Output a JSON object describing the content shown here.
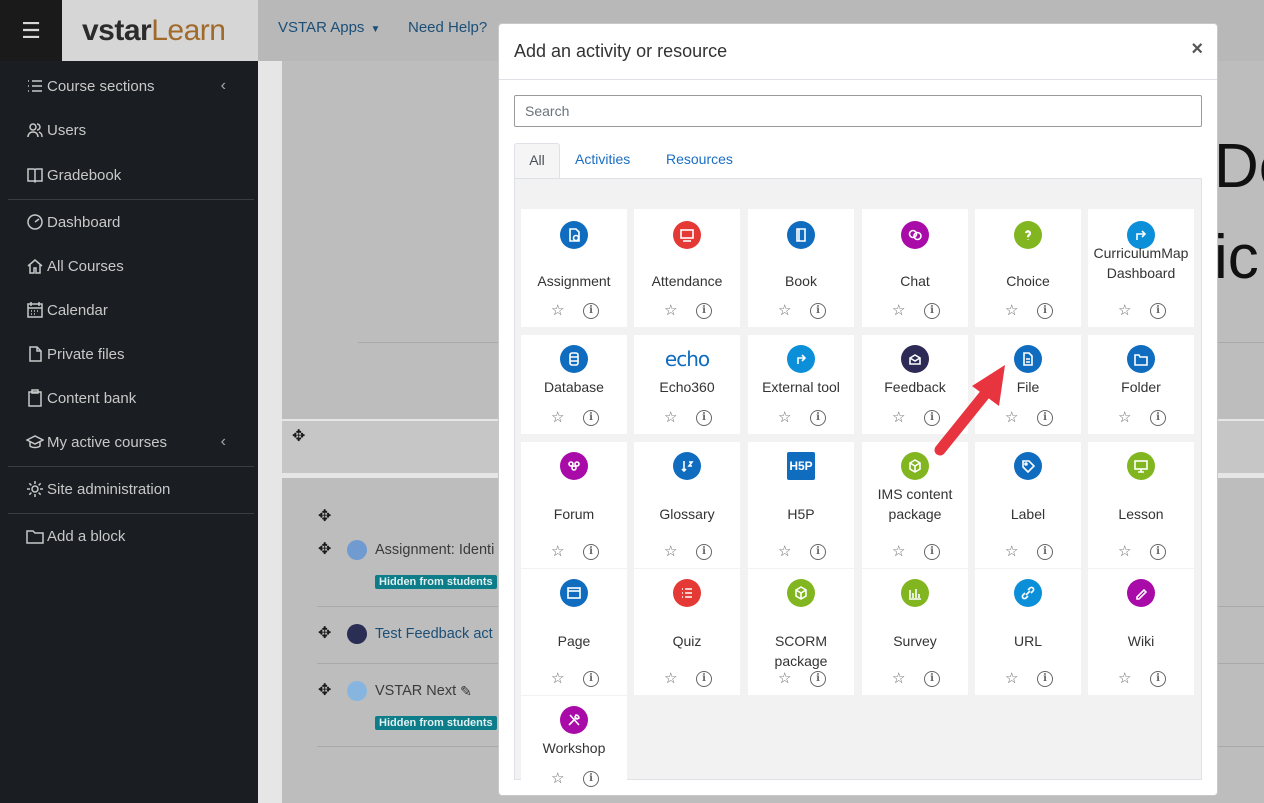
{
  "navbar": {
    "toggle_icon": "hamburger-icon",
    "logo": {
      "part1": "vstar",
      "part2": "Learn"
    },
    "apps_label": "VSTAR Apps",
    "help_label": "Need Help?"
  },
  "sidebar": {
    "items": [
      {
        "label": "Course sections",
        "icon": "list-icon"
      },
      {
        "label": "Users",
        "icon": "users-icon"
      },
      {
        "label": "Gradebook",
        "icon": "gradebook-icon"
      },
      {
        "label": "Dashboard",
        "icon": "dashboard-icon"
      },
      {
        "label": "All Courses",
        "icon": "home-icon"
      },
      {
        "label": "Calendar",
        "icon": "calendar-icon"
      },
      {
        "label": "Private files",
        "icon": "file-icon"
      },
      {
        "label": "Content bank",
        "icon": "clipboard-icon"
      },
      {
        "label": "My active courses",
        "icon": "graduation-cap-icon"
      },
      {
        "label": "Site administration",
        "icon": "gear-icon"
      },
      {
        "label": "Add a block",
        "icon": "folder-icon"
      }
    ]
  },
  "page": {
    "big_text_1": "De",
    "big_text_2": "ic",
    "activities": [
      {
        "name": "Assignment: Identi",
        "badge": "Hidden from students",
        "color": "#5b8fcf"
      },
      {
        "name": "Test Feedback act",
        "badge": "",
        "color": "#2a2d54"
      },
      {
        "name": "VSTAR Next",
        "badge": "Hidden from students",
        "color": "#6aa8de"
      }
    ]
  },
  "modal": {
    "title": "Add an activity or resource",
    "close": "×",
    "search_placeholder": "Search",
    "tabs": [
      "All",
      "Activities",
      "Resources"
    ],
    "items": [
      {
        "label": "Assignment",
        "color": "#0f6cbf",
        "icon": "assignment-icon"
      },
      {
        "label": "Attendance",
        "color": "#e53935",
        "icon": "attendance-icon"
      },
      {
        "label": "Book",
        "color": "#0f6cbf",
        "icon": "book-icon"
      },
      {
        "label": "Chat",
        "color": "#a80ba8",
        "icon": "chat-icon"
      },
      {
        "label": "Choice",
        "color": "#81b620",
        "icon": "choice-icon"
      },
      {
        "label": "CurriculumMap Dashboard",
        "color": "#0b8fd8",
        "icon": "curriculum-icon"
      },
      {
        "label": "Database",
        "color": "#0f6cbf",
        "icon": "database-icon"
      },
      {
        "label": "Echo360",
        "color": "#ffffff",
        "icon": "echo360-icon"
      },
      {
        "label": "External tool",
        "color": "#0b8fd8",
        "icon": "external-tool-icon"
      },
      {
        "label": "Feedback",
        "color": "#2d2b55",
        "icon": "feedback-icon"
      },
      {
        "label": "File",
        "color": "#0f6cbf",
        "icon": "file-icon"
      },
      {
        "label": "Folder",
        "color": "#0f6cbf",
        "icon": "folder-icon"
      },
      {
        "label": "Forum",
        "color": "#a80ba8",
        "icon": "forum-icon"
      },
      {
        "label": "Glossary",
        "color": "#0f6cbf",
        "icon": "glossary-icon"
      },
      {
        "label": "H5P",
        "color": "#0f6cbf",
        "icon": "h5p-icon"
      },
      {
        "label": "IMS content package",
        "color": "#81b620",
        "icon": "ims-package-icon"
      },
      {
        "label": "Label",
        "color": "#0f6cbf",
        "icon": "label-icon"
      },
      {
        "label": "Lesson",
        "color": "#81b620",
        "icon": "lesson-icon"
      },
      {
        "label": "Page",
        "color": "#0f6cbf",
        "icon": "page-icon"
      },
      {
        "label": "Quiz",
        "color": "#e53935",
        "icon": "quiz-icon"
      },
      {
        "label": "SCORM package",
        "color": "#81b620",
        "icon": "scorm-icon"
      },
      {
        "label": "Survey",
        "color": "#81b620",
        "icon": "survey-icon"
      },
      {
        "label": "URL",
        "color": "#0b8fd8",
        "icon": "url-icon"
      },
      {
        "label": "Wiki",
        "color": "#a80ba8",
        "icon": "wiki-icon"
      },
      {
        "label": "Workshop",
        "color": "#a80ba8",
        "icon": "workshop-icon"
      }
    ]
  },
  "annotation": {
    "arrow_color": "#e8343f"
  }
}
